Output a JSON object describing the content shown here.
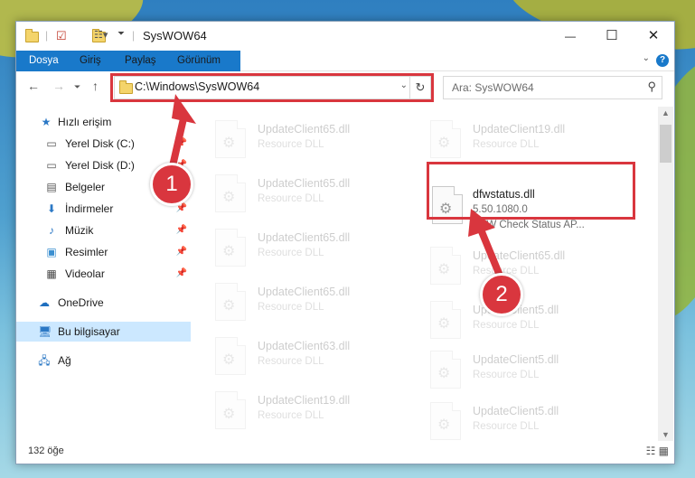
{
  "window": {
    "title": "SysWOW64",
    "controls": {
      "minimize": "—",
      "maximize": "☐",
      "close": "✕"
    }
  },
  "ribbon": {
    "tabs": [
      "Dosya",
      "Giriş",
      "Paylaş",
      "Görünüm"
    ],
    "help": "?"
  },
  "navbar": {
    "address_path": "C:\\Windows\\SysWOW64",
    "search_placeholder": "Ara: SysWOW64"
  },
  "sidebar": {
    "items": [
      {
        "label": "Hızlı erişim",
        "icon": "star-icon"
      },
      {
        "label": "Yerel Disk (C:)",
        "icon": "disk-icon",
        "pinned": true
      },
      {
        "label": "Yerel Disk (D:)",
        "icon": "disk-icon",
        "pinned": true
      },
      {
        "label": "Belgeler",
        "icon": "documents-icon",
        "pinned": true
      },
      {
        "label": "İndirmeler",
        "icon": "download-icon",
        "pinned": true
      },
      {
        "label": "Müzik",
        "icon": "music-icon",
        "pinned": true
      },
      {
        "label": "Resimler",
        "icon": "pictures-icon",
        "pinned": true
      },
      {
        "label": "Videolar",
        "icon": "videos-icon",
        "pinned": true
      },
      {
        "label": "OneDrive",
        "icon": "cloud-icon"
      },
      {
        "label": "Bu bilgisayar",
        "icon": "computer-icon",
        "selected": true
      },
      {
        "label": "Ağ",
        "icon": "network-icon"
      }
    ]
  },
  "files": {
    "left": [
      {
        "name": "UpdateClient65.dll",
        "type": "Resource DLL"
      },
      {
        "name": "UpdateClient65.dll",
        "type": "Resource DLL"
      },
      {
        "name": "UpdateClient65.dll",
        "type": "Resource DLL"
      },
      {
        "name": "UpdateClient65.dll",
        "type": "Resource DLL"
      },
      {
        "name": "UpdateClient63.dll",
        "type": "Resource DLL"
      },
      {
        "name": "UpdateClient19.dll",
        "type": "Resource DLL"
      }
    ],
    "right": [
      {
        "name": "UpdateClient19.dll",
        "type": "Resource DLL"
      },
      {
        "name": "UpdateClient65.dll",
        "type": "Resource DLL"
      },
      {
        "name": "UpdateClient5.dll",
        "type": "Resource DLL"
      },
      {
        "name": "UpdateClient5.dll",
        "type": "Resource DLL"
      },
      {
        "name": "UpdateClient5.dll",
        "type": "Resource DLL"
      }
    ],
    "highlighted": {
      "name": "dfwstatus.dll",
      "version": "5.50.1080.0",
      "description": "DFW Check Status AP..."
    }
  },
  "status": {
    "item_count": "132 öğe"
  },
  "annotations": {
    "badge1": "1",
    "badge2": "2",
    "color": "#d9363e"
  }
}
